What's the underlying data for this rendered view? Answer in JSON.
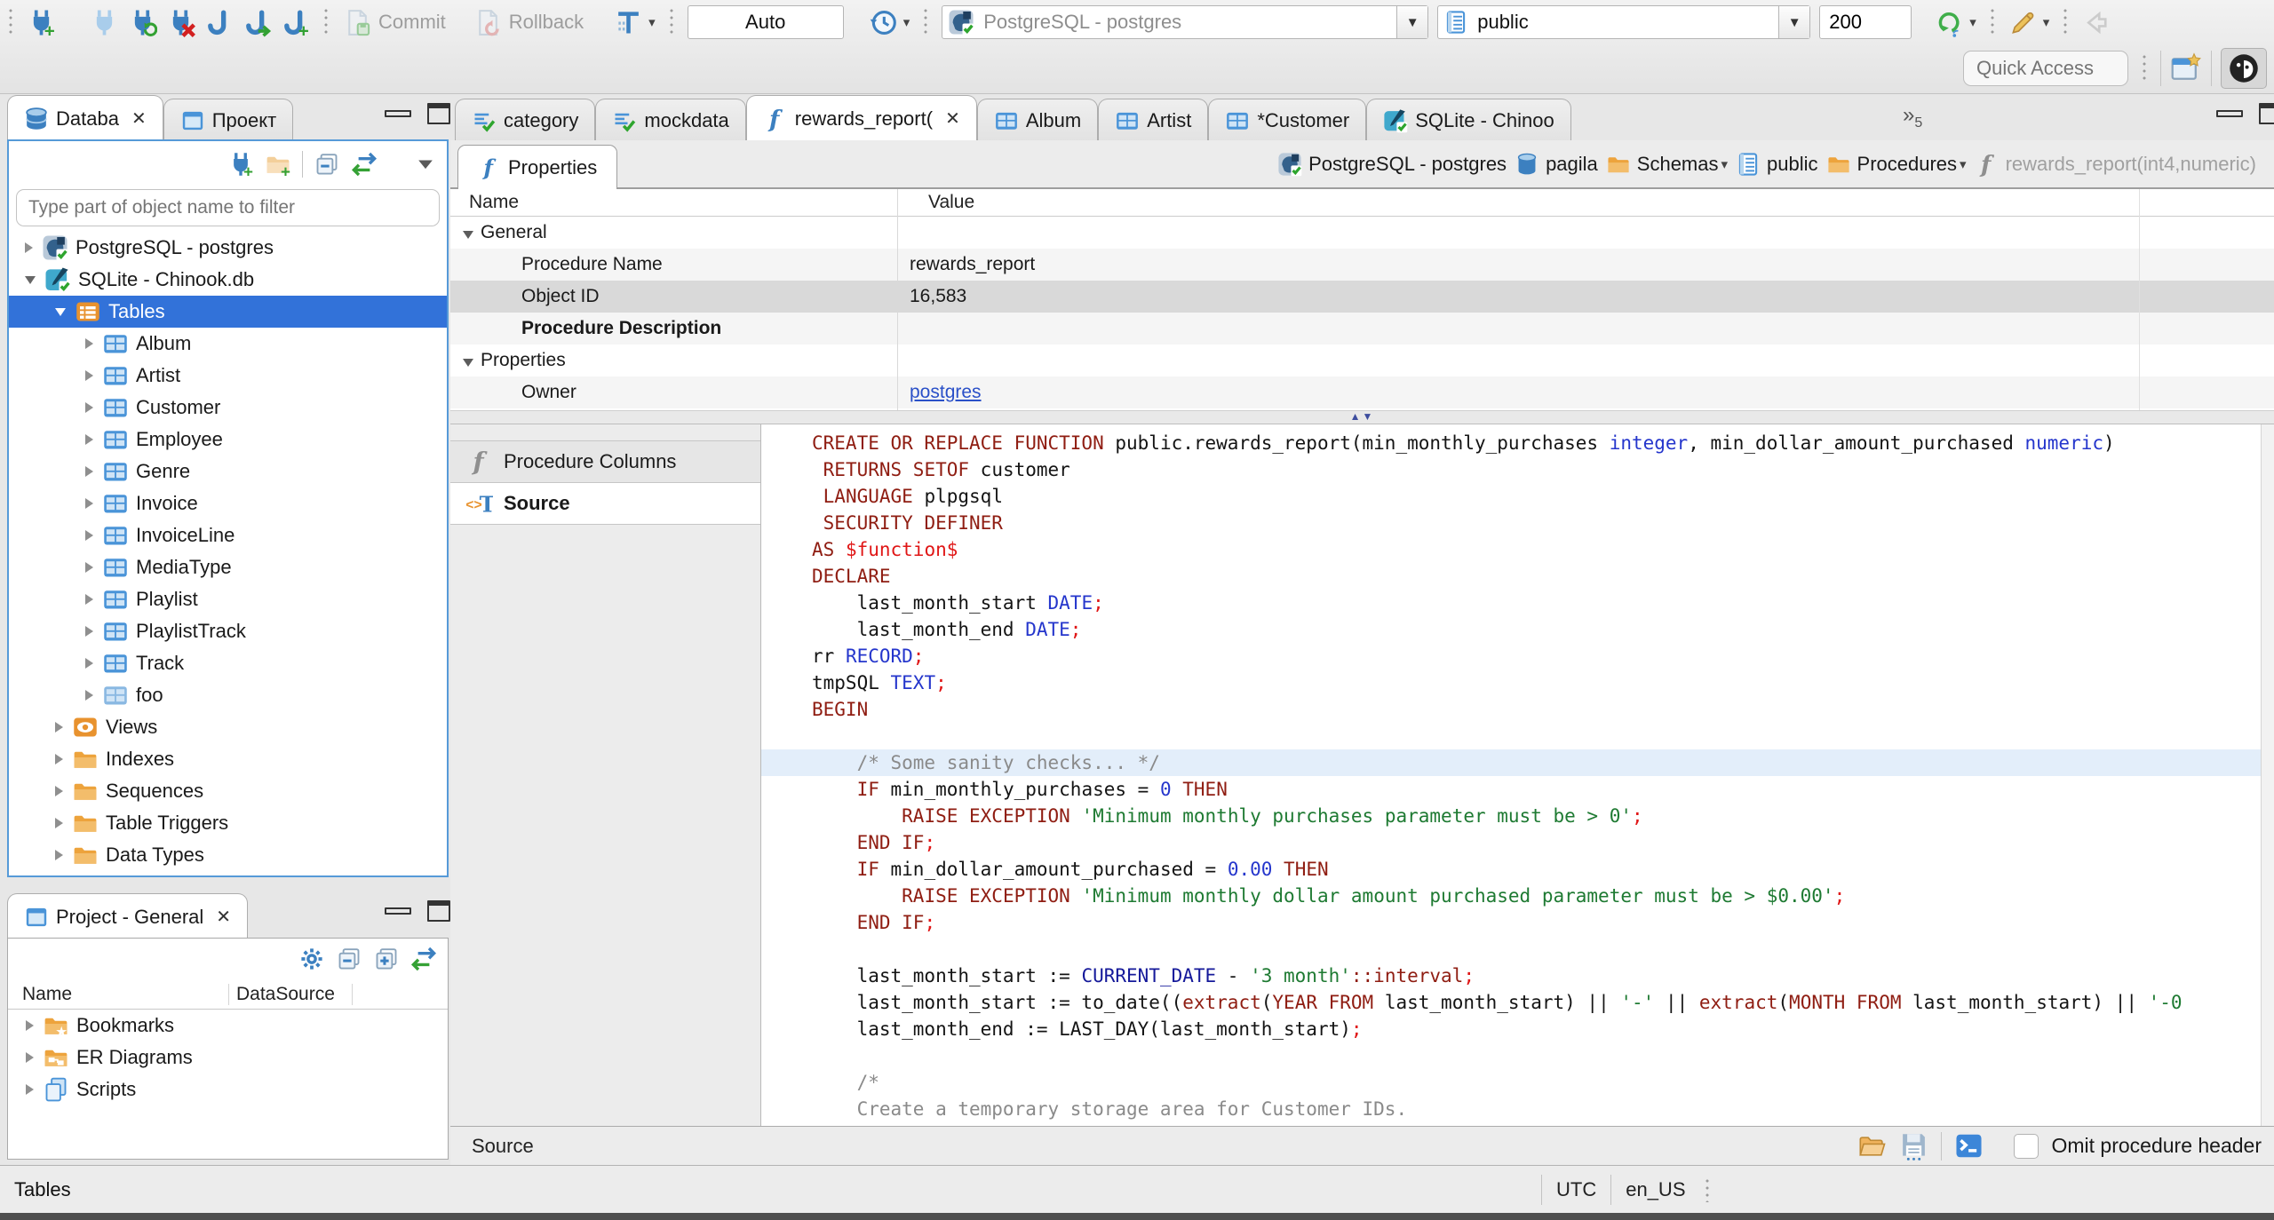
{
  "colors": {
    "accent_blue": "#3c80c0",
    "tree_selection": "#3272d9",
    "panel_focus_border": "#569ad8",
    "link": "#2a50c8",
    "code_keyword": "#8f1d12",
    "code_string": "#1e7a32",
    "code_number": "#2536cc",
    "code_type": "#2536cc",
    "code_builtin": "#15199a",
    "code_comment": "#8a8a8a",
    "code_red": "#e01616",
    "current_line_highlight": "#e3eefa"
  },
  "toolbar": {
    "commit_label": "Commit",
    "rollback_label": "Rollback",
    "auto_label": "Auto",
    "connection_value": "PostgreSQL - postgres",
    "schema_value": "public",
    "fetch_size": "200",
    "quick_access_placeholder": "Quick Access",
    "icons": [
      "new-connection",
      "connect",
      "reconnect",
      "disconnect",
      "sql-editor",
      "open-sql-script",
      "new-sql-editor",
      "commit",
      "rollback",
      "transaction-mode",
      "query-history",
      "refresh",
      "magic-wand",
      "back"
    ]
  },
  "left": {
    "tabs": [
      {
        "label": "Databa",
        "icon": "db-stack",
        "close": true,
        "active": true
      },
      {
        "label": "Проект",
        "icon": "window",
        "close": false,
        "active": false
      }
    ],
    "filter_placeholder": "Type part of object name to filter",
    "tree": [
      {
        "label": "PostgreSQL - postgres",
        "icon": "pg",
        "depth": 0,
        "arrow": "r"
      },
      {
        "label": "SQLite - Chinook.db",
        "icon": "sqlite",
        "depth": 0,
        "arrow": "d"
      },
      {
        "label": "Tables",
        "icon": "tables",
        "depth": 1,
        "arrow": "d",
        "selected": true
      },
      {
        "label": "Album",
        "icon": "table",
        "depth": 2,
        "arrow": "r"
      },
      {
        "label": "Artist",
        "icon": "table",
        "depth": 2,
        "arrow": "r"
      },
      {
        "label": "Customer",
        "icon": "table",
        "depth": 2,
        "arrow": "r"
      },
      {
        "label": "Employee",
        "icon": "table",
        "depth": 2,
        "arrow": "r"
      },
      {
        "label": "Genre",
        "icon": "table",
        "depth": 2,
        "arrow": "r"
      },
      {
        "label": "Invoice",
        "icon": "table",
        "depth": 2,
        "arrow": "r"
      },
      {
        "label": "InvoiceLine",
        "icon": "table",
        "depth": 2,
        "arrow": "r"
      },
      {
        "label": "MediaType",
        "icon": "table",
        "depth": 2,
        "arrow": "r"
      },
      {
        "label": "Playlist",
        "icon": "table",
        "depth": 2,
        "arrow": "r"
      },
      {
        "label": "PlaylistTrack",
        "icon": "table",
        "depth": 2,
        "arrow": "r"
      },
      {
        "label": "Track",
        "icon": "table",
        "depth": 2,
        "arrow": "r"
      },
      {
        "label": "foo",
        "icon": "table-light",
        "depth": 2,
        "arrow": "r"
      },
      {
        "label": "Views",
        "icon": "views",
        "depth": 1,
        "arrow": "r"
      },
      {
        "label": "Indexes",
        "icon": "folder",
        "depth": 1,
        "arrow": "r"
      },
      {
        "label": "Sequences",
        "icon": "folder",
        "depth": 1,
        "arrow": "r"
      },
      {
        "label": "Table Triggers",
        "icon": "folder",
        "depth": 1,
        "arrow": "r"
      },
      {
        "label": "Data Types",
        "icon": "folder",
        "depth": 1,
        "arrow": "r"
      }
    ]
  },
  "project_panel": {
    "tab_label": "Project - General",
    "columns": [
      "Name",
      "DataSource"
    ],
    "items": [
      {
        "label": "Bookmarks",
        "icon": "folder-star"
      },
      {
        "label": "ER Diagrams",
        "icon": "folder-er"
      },
      {
        "label": "Scripts",
        "icon": "scripts"
      }
    ]
  },
  "editor": {
    "tabs": [
      {
        "label": "category",
        "icon": "script-check"
      },
      {
        "label": "mockdata",
        "icon": "script-check"
      },
      {
        "label": "rewards_report(",
        "icon": "func",
        "active": true,
        "close": true
      },
      {
        "label": "Album",
        "icon": "table"
      },
      {
        "label": "Artist",
        "icon": "table"
      },
      {
        "label": "*Customer",
        "icon": "table"
      },
      {
        "label": "SQLite - Chinoo",
        "icon": "sqlite"
      }
    ],
    "overflow_count": "5",
    "properties_tab_label": "Properties",
    "breadcrumb": [
      {
        "label": "PostgreSQL - postgres",
        "icon": "pg"
      },
      {
        "label": "pagila",
        "icon": "db-cyl"
      },
      {
        "label": "Schemas",
        "icon": "folder",
        "dd": true
      },
      {
        "label": "public",
        "icon": "schema"
      },
      {
        "label": "Procedures",
        "icon": "folder",
        "dd": true
      },
      {
        "label": "rewards_report(int4,numeric)",
        "icon": "func-gray",
        "muted": true
      }
    ],
    "grid": {
      "name_header": "Name",
      "value_header": "Value",
      "rows": [
        {
          "name": "General",
          "value": "",
          "cat": true
        },
        {
          "name": "Procedure Name",
          "value": "rewards_report",
          "shade": true
        },
        {
          "name": "Object ID",
          "value": "16,583",
          "selected": true
        },
        {
          "name": "Procedure Description",
          "value": "",
          "bold": true,
          "shade": true
        },
        {
          "name": "Properties",
          "value": "",
          "cat": true
        },
        {
          "name": "Owner",
          "value": "postgres",
          "link": true,
          "shade": true
        }
      ]
    },
    "side_tabs": [
      {
        "label": "Procedure Columns",
        "icon": "func-gray"
      },
      {
        "label": "Source",
        "icon": "source",
        "active": true
      }
    ],
    "code_lines": [
      {
        "seg": [
          [
            "k",
            "CREATE OR REPLACE FUNCTION"
          ],
          [
            "p",
            " public.rewards_report(min_monthly_purchases "
          ],
          [
            "t",
            "integer"
          ],
          [
            "p",
            ", min_dollar_amount_purchased "
          ],
          [
            "t",
            "numeric"
          ],
          [
            "p",
            ")"
          ]
        ]
      },
      {
        "seg": [
          [
            "p",
            " "
          ],
          [
            "k",
            "RETURNS SETOF"
          ],
          [
            "p",
            " customer"
          ]
        ]
      },
      {
        "seg": [
          [
            "p",
            " "
          ],
          [
            "k",
            "LANGUAGE"
          ],
          [
            "p",
            " plpgsql"
          ]
        ]
      },
      {
        "seg": [
          [
            "p",
            " "
          ],
          [
            "k",
            "SECURITY DEFINER"
          ]
        ]
      },
      {
        "seg": [
          [
            "k",
            "AS"
          ],
          [
            "p",
            " "
          ],
          [
            "d",
            "$function$"
          ]
        ]
      },
      {
        "seg": [
          [
            "k",
            "DECLARE"
          ]
        ]
      },
      {
        "seg": [
          [
            "p",
            "    last_month_start "
          ],
          [
            "t",
            "DATE"
          ],
          [
            "d",
            ";"
          ]
        ]
      },
      {
        "seg": [
          [
            "p",
            "    last_month_end "
          ],
          [
            "t",
            "DATE"
          ],
          [
            "d",
            ";"
          ]
        ]
      },
      {
        "seg": [
          [
            "p",
            "rr "
          ],
          [
            "t",
            "RECORD"
          ],
          [
            "d",
            ";"
          ]
        ]
      },
      {
        "seg": [
          [
            "p",
            "tmpSQL "
          ],
          [
            "t",
            "TEXT"
          ],
          [
            "d",
            ";"
          ]
        ]
      },
      {
        "seg": [
          [
            "k",
            "BEGIN"
          ]
        ]
      },
      {
        "seg": []
      },
      {
        "hl": true,
        "seg": [
          [
            "c",
            "    /* Some sanity checks... */"
          ]
        ]
      },
      {
        "seg": [
          [
            "p",
            "    "
          ],
          [
            "k",
            "IF"
          ],
          [
            "p",
            " min_monthly_purchases = "
          ],
          [
            "n",
            "0"
          ],
          [
            "p",
            " "
          ],
          [
            "k",
            "THEN"
          ]
        ]
      },
      {
        "seg": [
          [
            "p",
            "        "
          ],
          [
            "k",
            "RAISE EXCEPTION"
          ],
          [
            "p",
            " "
          ],
          [
            "s",
            "'Minimum monthly purchases parameter must be > 0'"
          ],
          [
            "d",
            ";"
          ]
        ]
      },
      {
        "seg": [
          [
            "p",
            "    "
          ],
          [
            "k",
            "END IF"
          ],
          [
            "d",
            ";"
          ]
        ]
      },
      {
        "seg": [
          [
            "p",
            "    "
          ],
          [
            "k",
            "IF"
          ],
          [
            "p",
            " min_dollar_amount_purchased = "
          ],
          [
            "n",
            "0.00"
          ],
          [
            "p",
            " "
          ],
          [
            "k",
            "THEN"
          ]
        ]
      },
      {
        "seg": [
          [
            "p",
            "        "
          ],
          [
            "k",
            "RAISE EXCEPTION"
          ],
          [
            "p",
            " "
          ],
          [
            "s",
            "'Minimum monthly dollar amount purchased parameter must be > $0.00'"
          ],
          [
            "d",
            ";"
          ]
        ]
      },
      {
        "seg": [
          [
            "p",
            "    "
          ],
          [
            "k",
            "END IF"
          ],
          [
            "d",
            ";"
          ]
        ]
      },
      {
        "seg": []
      },
      {
        "seg": [
          [
            "p",
            "    last_month_start := "
          ],
          [
            "b",
            "CURRENT_DATE"
          ],
          [
            "p",
            " - "
          ],
          [
            "s",
            "'3 month'"
          ],
          [
            "k",
            "::interval"
          ],
          [
            "d",
            ";"
          ]
        ]
      },
      {
        "seg": [
          [
            "p",
            "    last_month_start := to_date(("
          ],
          [
            "k",
            "extract"
          ],
          [
            "p",
            "("
          ],
          [
            "k",
            "YEAR FROM"
          ],
          [
            "p",
            " last_month_start) || "
          ],
          [
            "s",
            "'-'"
          ],
          [
            "p",
            " || "
          ],
          [
            "k",
            "extract"
          ],
          [
            "p",
            "("
          ],
          [
            "k",
            "MONTH FROM"
          ],
          [
            "p",
            " last_month_start) || "
          ],
          [
            "s",
            "'-0"
          ]
        ]
      },
      {
        "seg": [
          [
            "p",
            "    last_month_end := LAST_DAY(last_month_start)"
          ],
          [
            "d",
            ";"
          ]
        ]
      },
      {
        "seg": []
      },
      {
        "seg": [
          [
            "c",
            "    /*"
          ]
        ]
      },
      {
        "seg": [
          [
            "c",
            "    Create a temporary storage area for Customer IDs."
          ]
        ]
      },
      {
        "seg": [
          [
            "c",
            "    */"
          ]
        ]
      }
    ],
    "bottom_bar": {
      "label": "Source",
      "omit_checkbox_label": "Omit procedure header"
    }
  },
  "statusbar": {
    "left": "Tables",
    "timezone": "UTC",
    "locale": "en_US"
  }
}
